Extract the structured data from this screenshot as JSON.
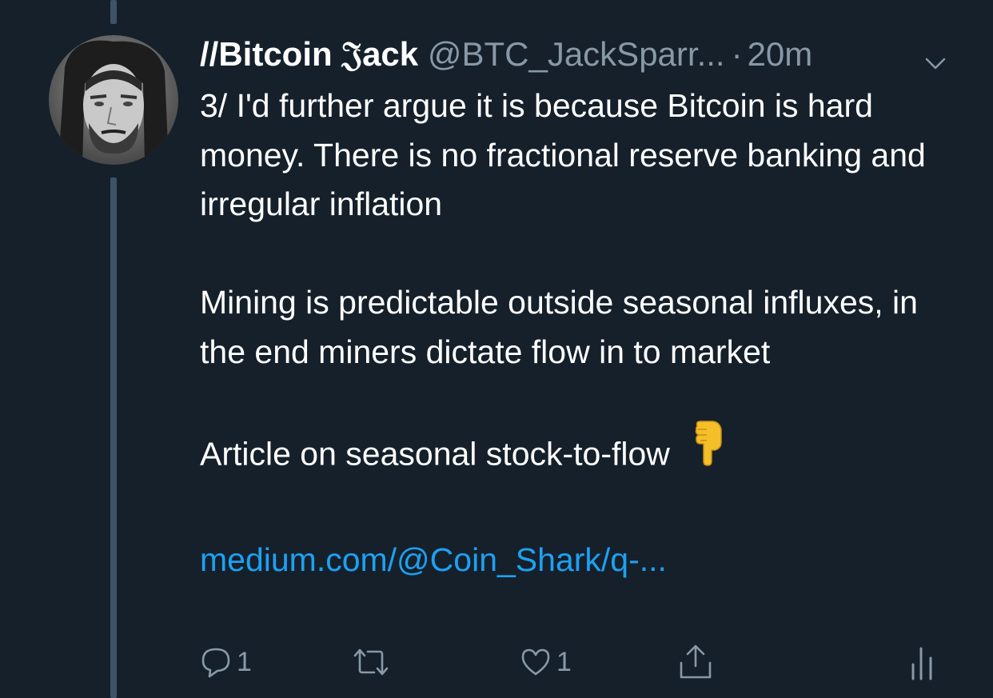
{
  "tweet": {
    "author": {
      "display_name": "//Bitcoin 𝔍ack",
      "handle": "@BTC_JackSparr...",
      "avatar_icon": "avatar-photo"
    },
    "separator": "·",
    "timestamp": "20m",
    "menu_icon": "chevron-down-icon",
    "body": {
      "paragraph_1": "3/ I'd further argue it is because Bitcoin is hard money. There is no fractional reserve banking and irregular inflation",
      "paragraph_2": "Mining is predictable outside seasonal influxes, in the end miners dictate flow in to market",
      "paragraph_3": "Article on seasonal stock-to-flow",
      "emoji": "backhand-index-pointing-down",
      "link_text": "medium.com/@Coin_Shark/q-..."
    },
    "actions": {
      "reply": {
        "icon": "reply-icon",
        "count": "1"
      },
      "retweet": {
        "icon": "retweet-icon",
        "count": ""
      },
      "like": {
        "icon": "heart-icon",
        "count": "1"
      },
      "share": {
        "icon": "share-icon"
      },
      "analytics": {
        "icon": "analytics-icon"
      }
    }
  },
  "colors": {
    "background": "#15202b",
    "thread_line": "#3d5466",
    "text_primary": "#ffffff",
    "text_secondary": "#8899a6",
    "link": "#1da1f2"
  }
}
